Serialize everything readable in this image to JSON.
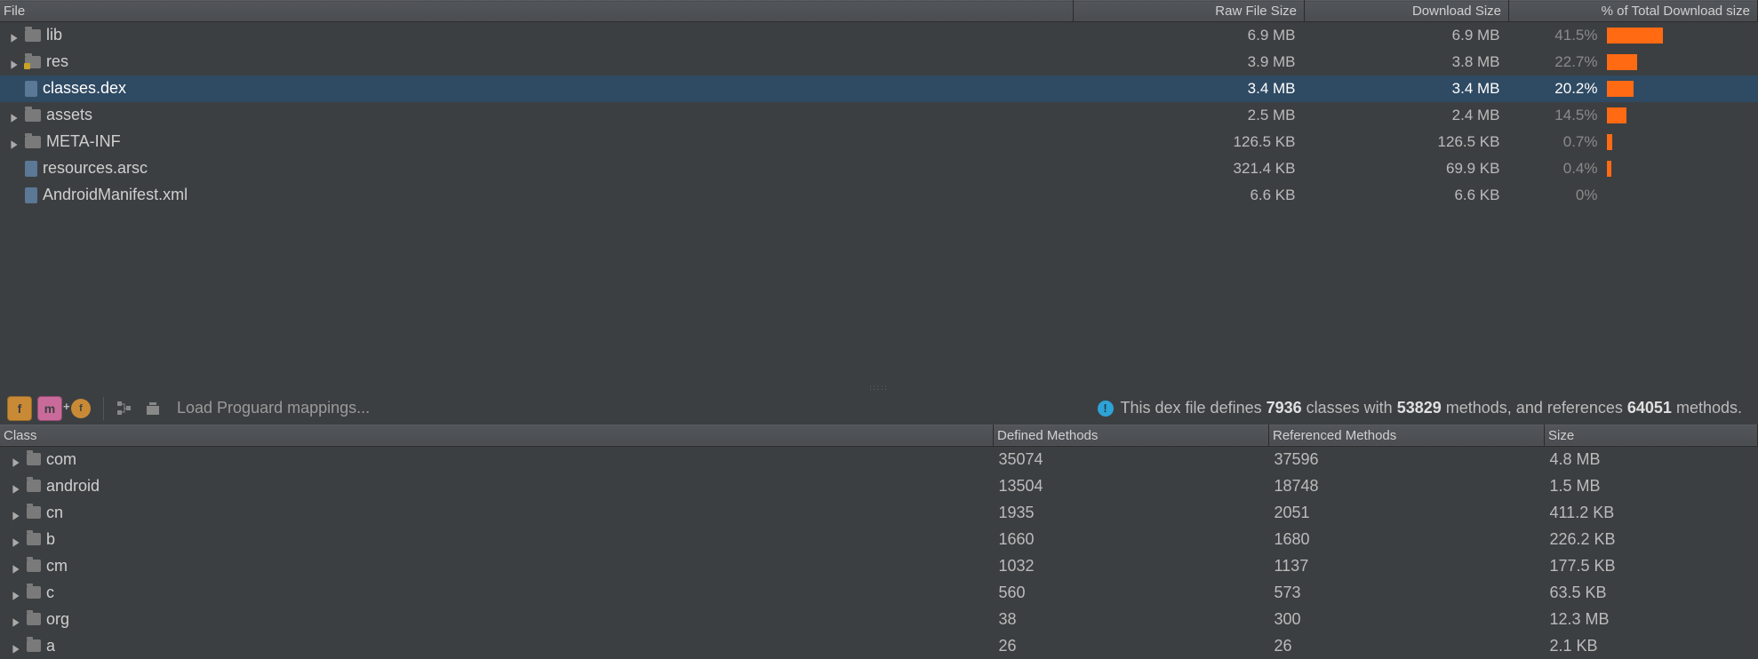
{
  "topTable": {
    "headers": {
      "file": "File",
      "raw": "Raw File Size",
      "download": "Download Size",
      "percent": "% of Total Download size"
    },
    "rows": [
      {
        "expand": true,
        "iconType": "folder",
        "name": "lib",
        "raw": "6.9 MB",
        "download": "6.9 MB",
        "percent": "41.5%",
        "barPct": 41.5,
        "selected": false
      },
      {
        "expand": true,
        "iconType": "folder-res",
        "name": "res",
        "raw": "3.9 MB",
        "download": "3.8 MB",
        "percent": "22.7%",
        "barPct": 22.7,
        "selected": false
      },
      {
        "expand": false,
        "iconType": "file",
        "name": "classes.dex",
        "raw": "3.4 MB",
        "download": "3.4 MB",
        "percent": "20.2%",
        "barPct": 20.2,
        "selected": true
      },
      {
        "expand": true,
        "iconType": "folder",
        "name": "assets",
        "raw": "2.5 MB",
        "download": "2.4 MB",
        "percent": "14.5%",
        "barPct": 14.5,
        "selected": false
      },
      {
        "expand": true,
        "iconType": "folder",
        "name": "META-INF",
        "raw": "126.5 KB",
        "download": "126.5 KB",
        "percent": "0.7%",
        "barPct": 0.7,
        "selected": false
      },
      {
        "expand": false,
        "iconType": "file",
        "name": "resources.arsc",
        "raw": "321.4 KB",
        "download": "69.9 KB",
        "percent": "0.4%",
        "barPct": 0.4,
        "selected": false
      },
      {
        "expand": false,
        "iconType": "file",
        "name": "AndroidManifest.xml",
        "raw": "6.6 KB",
        "download": "6.6 KB",
        "percent": "0%",
        "barPct": 0,
        "selected": false
      }
    ]
  },
  "toolbar": {
    "btnF": "f",
    "btnM": "m",
    "btnF2": "f",
    "loadMappings": "Load Proguard mappings..."
  },
  "summary": {
    "prefix": "This dex file defines ",
    "classes": "7936",
    "mid1": " classes with ",
    "methods": "53829",
    "mid2": " methods, and references ",
    "refMethods": "64051",
    "suffix": " methods."
  },
  "bottomTable": {
    "headers": {
      "cls": "Class",
      "def": "Defined Methods",
      "ref": "Referenced Methods",
      "size": "Size"
    },
    "rows": [
      {
        "name": "com",
        "def": "35074",
        "ref": "37596",
        "size": "4.8 MB"
      },
      {
        "name": "android",
        "def": "13504",
        "ref": "18748",
        "size": "1.5 MB"
      },
      {
        "name": "cn",
        "def": "1935",
        "ref": "2051",
        "size": "411.2 KB"
      },
      {
        "name": "b",
        "def": "1660",
        "ref": "1680",
        "size": "226.2 KB"
      },
      {
        "name": "cm",
        "def": "1032",
        "ref": "1137",
        "size": "177.5 KB"
      },
      {
        "name": "c",
        "def": "560",
        "ref": "573",
        "size": "63.5 KB"
      },
      {
        "name": "org",
        "def": "38",
        "ref": "300",
        "size": "12.3 MB"
      },
      {
        "name": "a",
        "def": "26",
        "ref": "26",
        "size": "2.1 KB"
      }
    ]
  }
}
